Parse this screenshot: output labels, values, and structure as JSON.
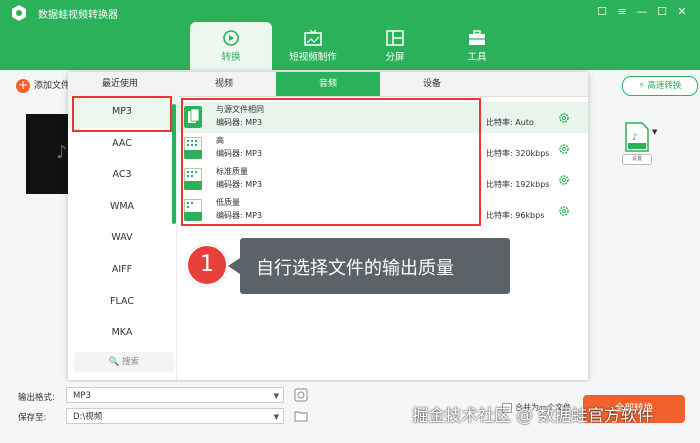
{
  "app": {
    "title": "数据蛙视频转换器"
  },
  "window_controls": [
    "☐",
    "≡",
    "—",
    "☐",
    "✕"
  ],
  "main_tabs": [
    {
      "label": "转换",
      "icon": "convert-icon",
      "active": true
    },
    {
      "label": "短视频制作",
      "icon": "tv-icon",
      "active": false
    },
    {
      "label": "分屏",
      "icon": "split-screen-icon",
      "active": false
    },
    {
      "label": "工具",
      "icon": "toolbox-icon",
      "active": false
    }
  ],
  "toolbar": {
    "add_file": "添加文件",
    "high_speed": "高速转换",
    "format_settings": "设置"
  },
  "popup": {
    "tabs": [
      "最近使用",
      "视频",
      "音频",
      "设备"
    ],
    "active_tab": "音频",
    "formats": [
      "MP3",
      "AAC",
      "AC3",
      "WMA",
      "WAV",
      "AIFF",
      "FLAC",
      "MKA"
    ],
    "selected_format": "MP3",
    "search_label": "搜索",
    "qualities": [
      {
        "name": "与源文件相同",
        "encoder": "编码器:  MP3",
        "bitrate": "比特率:  Auto",
        "badge": ""
      },
      {
        "name": "高",
        "encoder": "编码器:  MP3",
        "bitrate": "比特率:  320kbps",
        "badge": "H"
      },
      {
        "name": "标准质量",
        "encoder": "编码器:  MP3",
        "bitrate": "比特率:  192kbps",
        "badge": "M"
      },
      {
        "name": "低质量",
        "encoder": "编码器:  MP3",
        "bitrate": "比特率:  96kbps",
        "badge": "L"
      }
    ]
  },
  "callout": {
    "number": "1",
    "text": "自行选择文件的输出质量"
  },
  "bottom": {
    "output_format_label": "输出格式:",
    "output_format_value": "MP3",
    "save_to_label": "保存至:",
    "save_to_value": "D:\\视频",
    "merge_label": "合并为一个文件",
    "convert_all": "全部转换"
  },
  "watermark": "掘金技术社区 @ 数据蛙官方软件",
  "colors": {
    "brand_green": "#2bb15a",
    "accent_orange": "#f0622b",
    "highlight_red": "#e33333",
    "callout_bg": "#555c62"
  }
}
